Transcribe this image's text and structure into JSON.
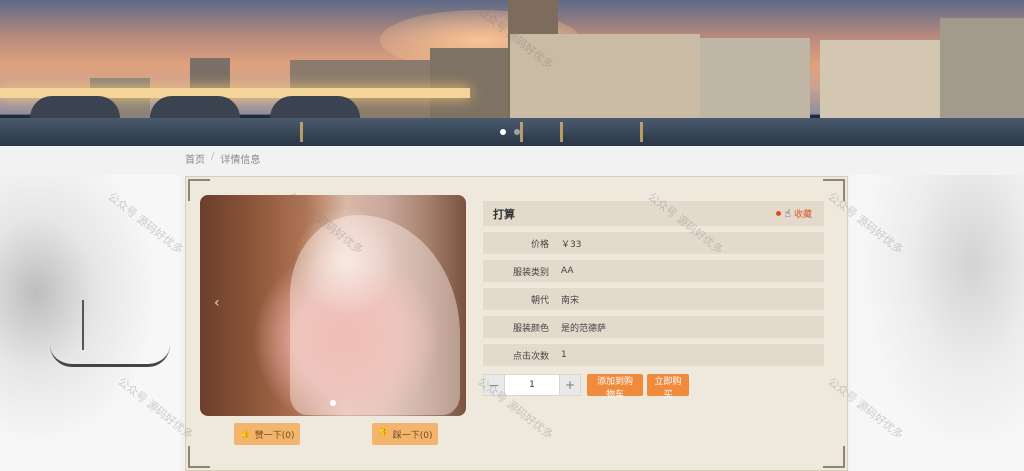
{
  "banner": {
    "active_slide": 1,
    "slide_count": 2
  },
  "breadcrumb": {
    "home": "首页",
    "separator": "/",
    "current": "详情信息"
  },
  "product": {
    "name": "打算",
    "favorite_label": "收藏",
    "fields": [
      {
        "label": "价格",
        "value": "￥33"
      },
      {
        "label": "服装类别",
        "value": "AA"
      },
      {
        "label": "朝代",
        "value": "南宋"
      },
      {
        "label": "服装颜色",
        "value": "是的范德萨"
      },
      {
        "label": "点击次数",
        "value": "1"
      }
    ]
  },
  "quantity": {
    "minus": "－",
    "value": "1",
    "plus": "+"
  },
  "actions": {
    "add_cart": "添加到购物车",
    "buy_now": "立即购买"
  },
  "votes": {
    "like": "赞一下(0)",
    "dislike": "踩一下(0)"
  },
  "watermark": "公众号 源码好优多",
  "colors": {
    "accent": "#f08a3c",
    "panel": "#efe8dc",
    "row": "#e4dacb",
    "vote": "#f1b56e"
  }
}
